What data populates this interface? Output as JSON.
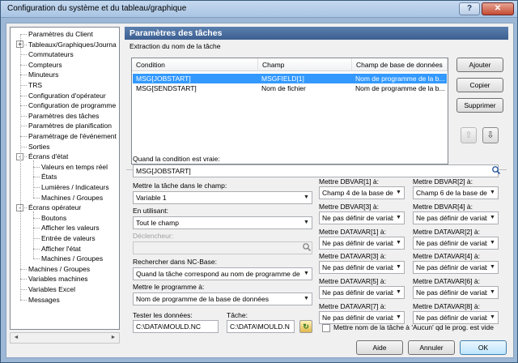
{
  "window": {
    "title": "Configuration du système et du tableau/graphique",
    "help_label": "?",
    "close_label": "✕"
  },
  "tree": {
    "items": [
      {
        "label": "Paramètres du Client",
        "level": 0
      },
      {
        "label": "Tableaux/Graphiques/Journa",
        "level": 0,
        "expander": "+"
      },
      {
        "label": "Commutateurs",
        "level": 0
      },
      {
        "label": "Compteurs",
        "level": 0
      },
      {
        "label": "Minuteurs",
        "level": 0
      },
      {
        "label": "TRS",
        "level": 0
      },
      {
        "label": "Configuration d'opérateur",
        "level": 0
      },
      {
        "label": "Configuration de programme",
        "level": 0
      },
      {
        "label": "Paramètres des tâches",
        "level": 0,
        "selected": true
      },
      {
        "label": "Paramètres de planification",
        "level": 0
      },
      {
        "label": "Paramétrage de l'événement",
        "level": 0
      },
      {
        "label": "Sorties",
        "level": 0
      },
      {
        "label": "Écrans d'état",
        "level": 0,
        "expander": "−"
      },
      {
        "label": "Valeurs en temps réel",
        "level": 1
      },
      {
        "label": "États",
        "level": 1
      },
      {
        "label": "Lumières / Indicateurs",
        "level": 1
      },
      {
        "label": "Machines / Groupes",
        "level": 1
      },
      {
        "label": "Écrans opérateur",
        "level": 0,
        "expander": "−"
      },
      {
        "label": "Boutons",
        "level": 1
      },
      {
        "label": "Afficher les valeurs",
        "level": 1
      },
      {
        "label": "Entrée de valeurs",
        "level": 1
      },
      {
        "label": "Afficher l'état",
        "level": 1
      },
      {
        "label": "Machines / Groupes",
        "level": 1
      },
      {
        "label": "Machines / Groupes",
        "level": 0
      },
      {
        "label": "Variables machines",
        "level": 0
      },
      {
        "label": "Variables Excel",
        "level": 0
      },
      {
        "label": "Messages",
        "level": 0
      }
    ],
    "scroll_left": "◄",
    "scroll_right": "►"
  },
  "panel": {
    "heading": "Paramètres des tâches",
    "extraction_label": "Extraction du nom de la tâche",
    "columns": [
      "Condition",
      "Champ",
      "Champ de base de données"
    ],
    "rows": [
      [
        "MSG[JOBSTART]",
        "MSGFIELD[1]",
        "Nom de programme de la b..."
      ],
      [
        "MSG[SENDSTART]",
        "Nom de fichier",
        "Nom de programme de la b..."
      ]
    ],
    "buttons": {
      "add": "Ajouter",
      "copy": "Copier",
      "delete": "Supprimer",
      "up": "⇧",
      "down": "⇩"
    },
    "condition_label": "Quand la condition est vraie:",
    "condition_value": "MSG[JOBSTART]",
    "field_label": "Mettre la tâche dans le champ:",
    "field_value": "Variable 1",
    "using_label": "En utilisant:",
    "using_value": "Tout le champ",
    "trigger_label": "Déclencheur:",
    "trigger_value": "",
    "search_label": "Rechercher dans NC-Base:",
    "search_value": "Quand la tâche correspond au nom de programme de la",
    "program_label": "Mettre le programme à:",
    "program_value": "Nom de programme de la base de données",
    "test_label": "Tester les données:",
    "test_value": "C:\\DATA\\MOULD.NC",
    "task_label": "Tâche:",
    "task_value": "C:\\DATA\\MOULD.N",
    "dbvar": [
      {
        "label": "Mettre DBVAR[1] à:",
        "value": "Champ 4 de la base de"
      },
      {
        "label": "Mettre DBVAR[2] à:",
        "value": "Champ 6 de la base de"
      },
      {
        "label": "Mettre DBVAR[3] à:",
        "value": "Ne pas définir de variab"
      },
      {
        "label": "Mettre DBVAR[4] à:",
        "value": "Ne pas définir de variab"
      }
    ],
    "datavar": [
      {
        "label": "Mettre DATAVAR[1] à:",
        "value": "Ne pas définir de variab"
      },
      {
        "label": "Mettre DATAVAR[2] à:",
        "value": "Ne pas définir de variab"
      },
      {
        "label": "Mettre DATAVAR[3] à:",
        "value": "Ne pas définir de variab"
      },
      {
        "label": "Mettre DATAVAR[4] à:",
        "value": "Ne pas définir de variab"
      },
      {
        "label": "Mettre DATAVAR[5] à:",
        "value": "Ne pas définir de variab"
      },
      {
        "label": "Mettre DATAVAR[6] à:",
        "value": "Ne pas définir de variab"
      },
      {
        "label": "Mettre DATAVAR[7] à:",
        "value": "Ne pas définir de variab"
      },
      {
        "label": "Mettre DATAVAR[8] à:",
        "value": "Ne pas définir de variab"
      }
    ],
    "none_checkbox_label": "Mettre nom de la tâche à 'Aucun' qd le prog. est vide"
  },
  "footer": {
    "help": "Aide",
    "cancel": "Annuler",
    "ok": "OK"
  }
}
